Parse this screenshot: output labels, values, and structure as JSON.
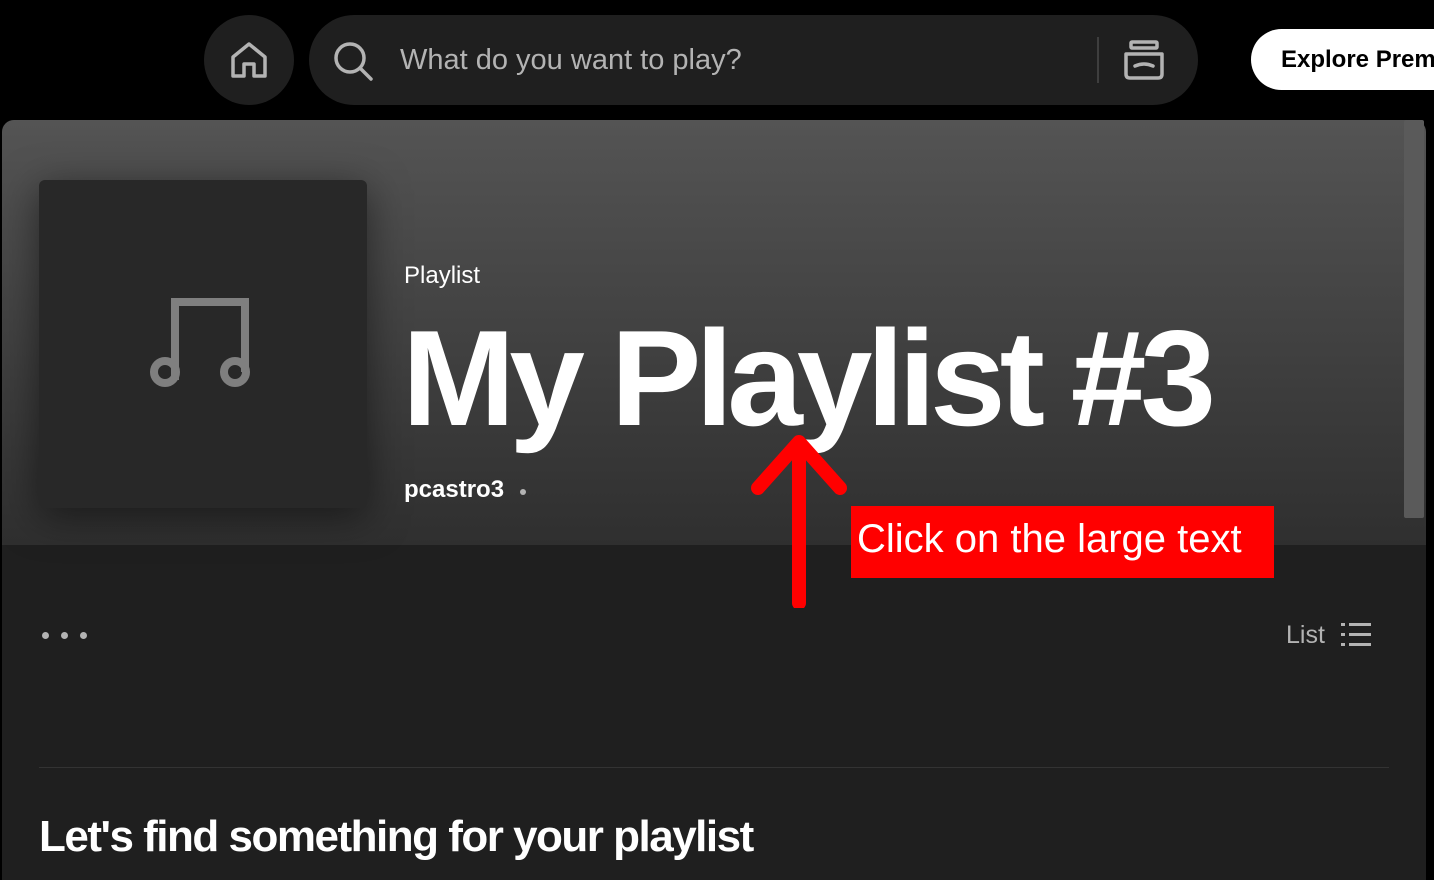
{
  "topbar": {
    "home_icon": "home-icon",
    "search_placeholder": "What do you want to play?",
    "search_icon": "search-icon",
    "browse_icon": "browse-icon",
    "premium_button": "Explore Premium"
  },
  "playlist": {
    "cover_icon": "music-note-icon",
    "type_label": "Playlist",
    "title": "My Playlist #3",
    "owner": "pcastro3"
  },
  "actions": {
    "more_icon": "more-dots-icon",
    "view_label": "List",
    "view_icon": "list-icon"
  },
  "recommend": {
    "title": "Let's find something for your playlist"
  },
  "annotation": {
    "text": "Click on the large text",
    "color": "#ff0000"
  },
  "colors": {
    "background": "#000000",
    "surface": "#1f1f1f",
    "hero_top": "#545454",
    "text_muted": "#b3b3b3"
  }
}
